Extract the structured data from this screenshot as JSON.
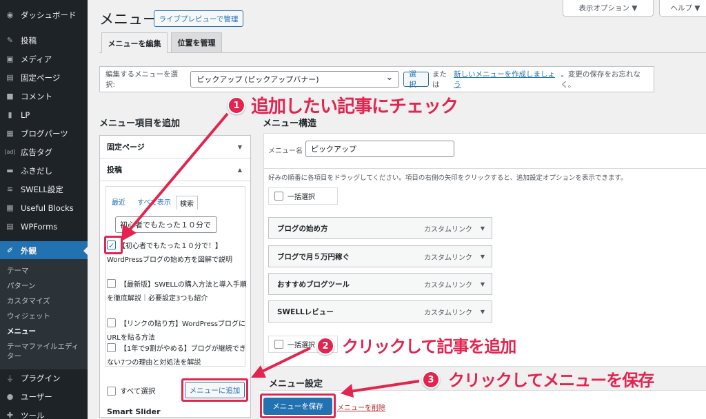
{
  "sidebar": {
    "items": [
      {
        "label": "ダッシュボード",
        "icon": "dashboard-icon"
      },
      {
        "label": "投稿",
        "icon": "pin-icon"
      },
      {
        "label": "メディア",
        "icon": "media-icon"
      },
      {
        "label": "固定ページ",
        "icon": "page-icon"
      },
      {
        "label": "コメント",
        "icon": "comment-icon"
      },
      {
        "label": "LP",
        "icon": "lp-icon"
      },
      {
        "label": "ブログパーツ",
        "icon": "blocks-icon"
      },
      {
        "label": "広告タグ",
        "icon": "ad-icon"
      },
      {
        "label": "ふきだし",
        "icon": "balloon-icon"
      },
      {
        "label": "SWELL設定",
        "icon": "swell-icon"
      },
      {
        "label": "Useful Blocks",
        "icon": "grid-icon"
      },
      {
        "label": "WPForms",
        "icon": "forms-icon"
      },
      {
        "label": "外観",
        "icon": "brush-icon"
      },
      {
        "label": "プラグイン",
        "icon": "plugin-icon"
      },
      {
        "label": "ユーザー",
        "icon": "user-icon"
      },
      {
        "label": "ツール",
        "icon": "tool-icon"
      }
    ],
    "submenu": [
      "テーマ",
      "パターン",
      "カスタマイズ",
      "ウィジェット",
      "メニュー",
      "テーマファイルエディター"
    ]
  },
  "header": {
    "title": "メニュー",
    "live_preview": "ライブプレビューで管理",
    "screen_options": "表示オプション ▼",
    "help": "ヘルプ ▼"
  },
  "tabs": [
    "メニューを編集",
    "位置を管理"
  ],
  "select_bar": {
    "label": "編集するメニューを選択:",
    "value": "ピックアップ (ピックアップバナー)",
    "button": "選択",
    "text_before": "または",
    "link": "新しいメニューを作成しましょう",
    "text_after": "。変更の保存をお忘れなく。"
  },
  "add_items": {
    "heading": "メニュー項目を追加",
    "panel_pages": "固定ページ",
    "panel_posts": "投稿",
    "inner_tabs": [
      "最近",
      "すべて表示",
      "検索"
    ],
    "search_value": "初心者でもたった１０分で",
    "posts": [
      {
        "title": "【初心者でもたった１０分で！】WordPressブログの始め方を図解で説明",
        "checked": true
      },
      {
        "title": "【最新版】SWELLの購入方法と導入手順を徹底解説｜必要設定3つも紹介",
        "checked": false
      },
      {
        "title": "【リンクの貼り方】WordPressブログにURLを貼る方法",
        "checked": false
      },
      {
        "title": "【1年で9割がやめる】ブログが継続できない7つの理由と対処法を解説",
        "checked": false
      }
    ],
    "select_all": "すべて選択",
    "add_button": "メニューに追加",
    "next_panel": "Smart Slider"
  },
  "structure": {
    "heading": "メニュー構造",
    "name_label": "メニュー名",
    "name_value": "ピックアップ",
    "instructions": "好みの順番に各項目をドラッグしてください。項目の右側の矢印をクリックすると、追加設定オプションを表示できます。",
    "bulk_select": "一括選択",
    "items": [
      {
        "title": "ブログの始め方",
        "type": "カスタムリンク"
      },
      {
        "title": "ブログで月５万円稼ぐ",
        "type": "カスタムリンク"
      },
      {
        "title": "おすすめブログツール",
        "type": "カスタムリンク"
      },
      {
        "title": "SWELLレビュー",
        "type": "カスタムリンク"
      }
    ]
  },
  "settings": {
    "heading": "メニュー設定",
    "save": "メニューを保存",
    "delete": "メニューを削除"
  },
  "annotations": [
    {
      "num": "1",
      "text": "追加したい記事にチェック"
    },
    {
      "num": "2",
      "text": "クリックして記事を追加"
    },
    {
      "num": "3",
      "text": "クリックしてメニューを保存"
    }
  ],
  "colors": {
    "accent": "#2271b1",
    "annotation": "#e2244f",
    "sidebar": "#1d2327"
  }
}
